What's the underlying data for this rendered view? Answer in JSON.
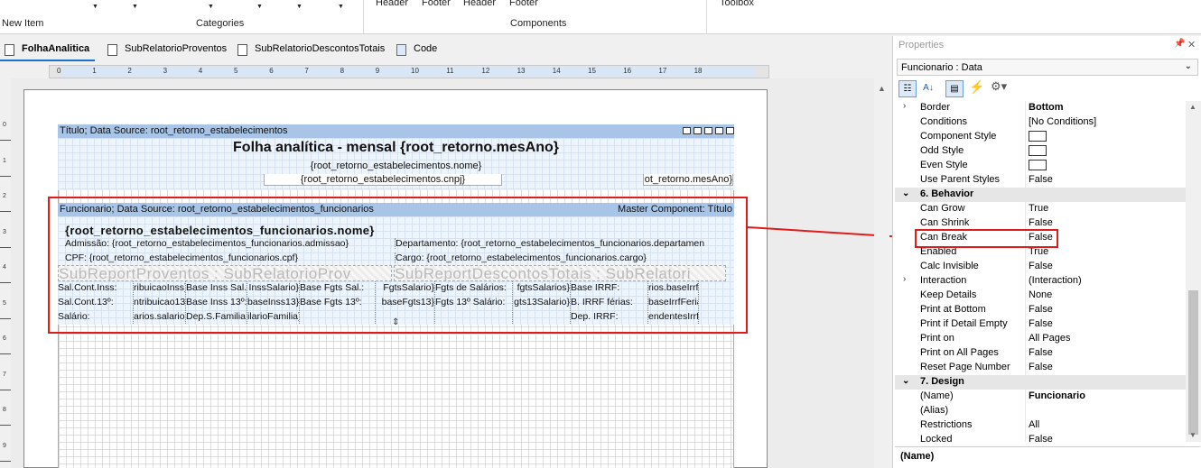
{
  "ribbon": {
    "new_item": "New Item",
    "categories": "Categories",
    "components": "Components",
    "header1": "Header",
    "footer1": "Footer",
    "header2": "Header",
    "footer2": "Footer",
    "toolbox": "Toolbox"
  },
  "tabs": [
    {
      "label": "FolhaAnalitica",
      "active": true
    },
    {
      "label": "SubRelatorioProventos"
    },
    {
      "label": "SubRelatorioDescontosTotais"
    },
    {
      "label": "Code"
    }
  ],
  "ruler": {
    "marks": [
      "0",
      "1",
      "2",
      "3",
      "4",
      "5",
      "6",
      "7",
      "8",
      "9",
      "10",
      "11",
      "12",
      "13",
      "14",
      "15",
      "16",
      "17",
      "18"
    ],
    "vmarks": [
      "0",
      "1",
      "2",
      "3",
      "4",
      "5",
      "6",
      "7",
      "8",
      "9"
    ]
  },
  "report": {
    "title_band": "Título; Data Source: root_retorno_estabelecimentos",
    "title_text": "Folha analítica - mensal {root_retorno.mesAno}",
    "est_nome": "{root_retorno_estabelecimentos.nome}",
    "est_cnpj": "{root_retorno_estabelecimentos.cnpj}",
    "mesano_right": "ot_retorno.mesAno}",
    "func_band": "Funcionario; Data Source: root_retorno_estabelecimentos_funcionarios",
    "func_master": "Master Component: Título",
    "func_nome": "{root_retorno_estabelecimentos_funcionarios.nome}",
    "admissao": "Admissão: {root_retorno_estabelecimentos_funcionarios.admissao}",
    "cpf": "CPF: {root_retorno_estabelecimentos_funcionarios.cpf}",
    "departamento": "Departamento: {root_retorno_estabelecimentos_funcionarios.departamen",
    "cargo": "Cargo: {root_retorno_estabelecimentos_funcionarios.cargo}",
    "sub_left": "SubReportProventos : SubRelatorioProv",
    "sub_right": "SubReportDescontosTotais : SubRelatori",
    "grid_rows": [
      [
        "Sal.Cont.Inss:",
        "ribuicaoInss}",
        "Base Inss Sal.:",
        "InssSalario}",
        "Base Fgts Sal.:",
        "FgtsSalario}",
        "Fgts de Salários:",
        "fgtsSalarios}",
        "Base IRRF:",
        "rios.baseIrrf}"
      ],
      [
        "Sal.Cont.13º:",
        "ntribuicao13}",
        "Base Inss 13º:",
        "baseInss13}",
        "Base Fgts 13º:",
        "baseFgts13}",
        "Fgts 13º Salário:",
        "gts13Salario}",
        "B. IRRF férias:",
        "baseIrrfFerias}"
      ],
      [
        "Salário:",
        "arios.salario}",
        "Dep.S.Familia:",
        "ilarioFamilia}",
        "",
        "",
        "",
        "",
        "Dep. IRRF:",
        "endentesIrrf}"
      ]
    ]
  },
  "props": {
    "title": "Properties",
    "object": "Funcionario : Data",
    "rows": [
      {
        "type": "prop",
        "name": "Border",
        "value": "Bottom",
        "bold": true,
        "expand": true
      },
      {
        "type": "prop",
        "name": "Conditions",
        "value": "[No Conditions]"
      },
      {
        "type": "prop",
        "name": "Component Style",
        "value": "",
        "box": true
      },
      {
        "type": "prop",
        "name": "Odd Style",
        "value": "",
        "box": true
      },
      {
        "type": "prop",
        "name": "Even Style",
        "value": "",
        "box": true
      },
      {
        "type": "prop",
        "name": "Use Parent Styles",
        "value": "False"
      },
      {
        "type": "cat",
        "name": "6. Behavior"
      },
      {
        "type": "prop",
        "name": "Can Grow",
        "value": "True"
      },
      {
        "type": "prop",
        "name": "Can Shrink",
        "value": "False"
      },
      {
        "type": "prop",
        "name": "Can Break",
        "value": "False",
        "highlight": true
      },
      {
        "type": "prop",
        "name": "Enabled",
        "value": "True"
      },
      {
        "type": "prop",
        "name": "Calc Invisible",
        "value": "False"
      },
      {
        "type": "prop",
        "name": "Interaction",
        "value": "(Interaction)",
        "expand": true
      },
      {
        "type": "prop",
        "name": "Keep Details",
        "value": "None"
      },
      {
        "type": "prop",
        "name": "Print at Bottom",
        "value": "False"
      },
      {
        "type": "prop",
        "name": "Print if Detail Empty",
        "value": "False"
      },
      {
        "type": "prop",
        "name": "Print on",
        "value": "All Pages"
      },
      {
        "type": "prop",
        "name": "Print on All Pages",
        "value": "False"
      },
      {
        "type": "prop",
        "name": "Reset Page Number",
        "value": "False"
      },
      {
        "type": "cat",
        "name": "7. Design"
      },
      {
        "type": "prop",
        "name": "(Name)",
        "value": "Funcionario",
        "bold": true
      },
      {
        "type": "prop",
        "name": "(Alias)",
        "value": ""
      },
      {
        "type": "prop",
        "name": "Restrictions",
        "value": "All"
      },
      {
        "type": "prop",
        "name": "Locked",
        "value": "False"
      }
    ],
    "desc_name": "(Name)"
  },
  "colors": {
    "accent": "#1a73c8",
    "band": "#a8c4e6",
    "highlight": "#e01b1b",
    "bolt": "#f5b800"
  }
}
